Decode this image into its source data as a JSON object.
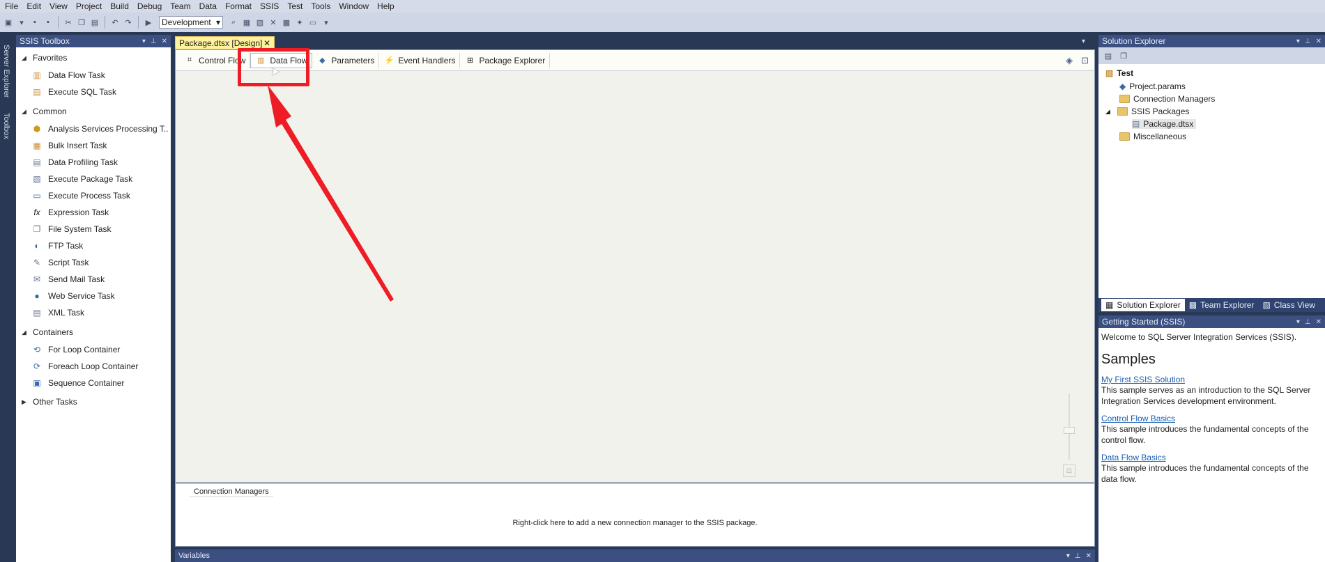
{
  "menubar": {
    "items": [
      "File",
      "Edit",
      "View",
      "Project",
      "Build",
      "Debug",
      "Team",
      "Data",
      "Format",
      "SSIS",
      "Test",
      "Tools",
      "Window",
      "Help"
    ]
  },
  "toolbar": {
    "config_select": "Development"
  },
  "left_strip": {
    "server_explorer": "Server Explorer",
    "toolbox": "Toolbox"
  },
  "toolbox": {
    "title": "SSIS Toolbox",
    "groups": {
      "favorites": {
        "label": "Favorites",
        "items": [
          "Data Flow Task",
          "Execute SQL Task"
        ]
      },
      "common": {
        "label": "Common",
        "items": [
          "Analysis Services Processing T...",
          "Bulk Insert Task",
          "Data Profiling Task",
          "Execute Package Task",
          "Execute Process Task",
          "Expression Task",
          "File System Task",
          "FTP Task",
          "Script Task",
          "Send Mail Task",
          "Web Service Task",
          "XML Task"
        ]
      },
      "containers": {
        "label": "Containers",
        "items": [
          "For Loop Container",
          "Foreach Loop Container",
          "Sequence Container"
        ]
      },
      "other": {
        "label": "Other Tasks"
      }
    }
  },
  "document": {
    "tab_title": "Package.dtsx [Design]",
    "designer_tabs": [
      "Control Flow",
      "Data Flow",
      "Parameters",
      "Event Handlers",
      "Package Explorer"
    ],
    "active_tab": "Data Flow",
    "connection_managers_tab": "Connection Managers",
    "connection_managers_hint": "Right-click here to add a new connection manager to the SSIS package.",
    "variables_bar": "Variables"
  },
  "solution_explorer": {
    "title": "Solution Explorer",
    "project": "Test",
    "nodes": [
      "Project.params",
      "Connection Managers",
      "SSIS Packages",
      "Package.dtsx",
      "Miscellaneous"
    ],
    "tabs": [
      "Solution Explorer",
      "Team Explorer",
      "Class View"
    ]
  },
  "getting_started": {
    "title": "Getting Started (SSIS)",
    "welcome": "Welcome to SQL Server Integration Services (SSIS).",
    "samples_heading": "Samples",
    "samples": [
      {
        "link": "My First SSIS Solution",
        "desc": "This sample serves as an introduction to the SQL Server Integration Services development environment."
      },
      {
        "link": "Control Flow Basics",
        "desc": "This sample introduces the fundamental concepts of the control flow."
      },
      {
        "link": "Data Flow Basics",
        "desc": "This sample introduces the fundamental concepts of the data flow."
      }
    ]
  },
  "colors": {
    "annotation": "#ee1c25",
    "panel_header": "#3b4f81",
    "active_doc_tab": "#fff29d"
  }
}
